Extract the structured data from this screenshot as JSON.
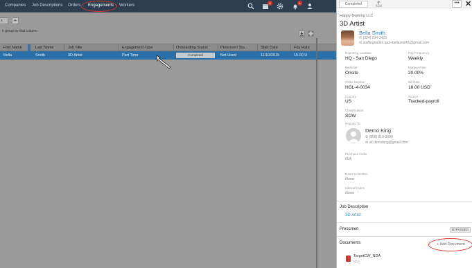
{
  "nav": {
    "items": [
      "Companies",
      "Job Descriptions",
      "Orders",
      "Engagements",
      "Workers"
    ],
    "active": "Engagements",
    "icons": [
      "search-icon",
      "calendar-icon",
      "gear-icon",
      "bell-icon",
      "user-icon"
    ],
    "badges": {
      "calendar": "6",
      "bell": "4"
    },
    "colors": {
      "bar": "#2c3e50",
      "highlight": "#d9342b"
    }
  },
  "grid": {
    "tab_stub": "s",
    "add_tab": "+",
    "group_hint": "o group by that column",
    "columns": [
      "First Name",
      "Last Name",
      "Job Title",
      "Engagement Type",
      "Onboarding Status",
      "Prescreen Sta...",
      "Start Date",
      "Pay Rate"
    ],
    "row": {
      "first_name": "Bella",
      "last_name": "Smith",
      "job_title": "3D Artist",
      "engagement_type": "Part Time",
      "onboarding_status": "Completed",
      "prescreen_status": "Not Used",
      "start_date": "11/10/2019",
      "pay_rate": "15.00 U"
    },
    "selected_color": "#2a6fa8"
  },
  "panel": {
    "status_tab": "Completed",
    "more_label": "•••",
    "close_label": "✕",
    "company": "Happy Gaming LLC",
    "title": "3D Artist",
    "candidate": {
      "name": "Bella Smith",
      "phone": "(324) 234-2423",
      "email": "staffingnation.qa1+bellasmith5@gmail.com"
    },
    "fields": [
      {
        "label": "Reporting Location",
        "value": "HQ - San Diego"
      },
      {
        "label": "Pay Frequency",
        "value": "Weekly"
      },
      {
        "label": "Worksite",
        "value": "Onsite"
      },
      {
        "label": "Markup Rate",
        "value": "20.00%"
      },
      {
        "label": "Order Number",
        "value": "HGL-4-0034"
      },
      {
        "label": "Bill Rate",
        "value": "18.00 USD"
      },
      {
        "label": "Country",
        "value": "US"
      },
      {
        "label": "Source",
        "value": "Tracked-payroll"
      },
      {
        "label": "Classification",
        "value": "SOW"
      }
    ],
    "reports_to": {
      "label": "Reports To",
      "name": "Demo King",
      "phone": "(858) 810-3000",
      "email": "sk.demoking@gmail.com"
    },
    "purchase_order": {
      "label": "Purchase Order",
      "value": "N/A"
    },
    "notes_to_worker": {
      "label": "Notes to Worker",
      "value": "None"
    },
    "internal_notes": {
      "label": "Internal Notes",
      "value": "None"
    },
    "job_description": {
      "title": "Job Description",
      "value": "3D Artist"
    },
    "prescreen": {
      "title": "Prescreen",
      "badge": "BYPASSED"
    },
    "documents": {
      "title": "Documents",
      "add_label": "Add Document",
      "items": [
        {
          "name": "TargetCW_NDA",
          "sub": "NDA"
        }
      ]
    }
  }
}
